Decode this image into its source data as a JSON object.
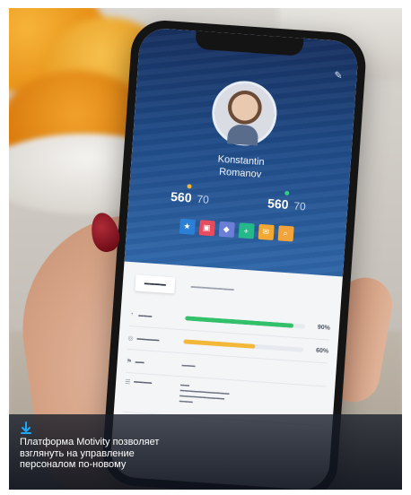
{
  "caption": {
    "line1": "Платформа Motivity позволяет",
    "line2": "взглянуть на управление",
    "line3": "персоналом по-новому",
    "accent": "#1ea7ff"
  },
  "phone_app": {
    "user_name_line1": "Konstantin",
    "user_name_line2": "Romanov",
    "stats": [
      {
        "main": "560",
        "sub": "70",
        "dot": "#f5b731"
      },
      {
        "main": "560",
        "sub": "70",
        "dot": "#2fd27a"
      }
    ],
    "actions": [
      {
        "icon": "star-icon",
        "glyph": "★",
        "color": "#2b7fd6"
      },
      {
        "icon": "gift-icon",
        "glyph": "▣",
        "color": "#e74c5e"
      },
      {
        "icon": "chat-icon",
        "glyph": "◆",
        "color": "#6c7fd8"
      },
      {
        "icon": "plus-icon",
        "glyph": "+",
        "color": "#25b88a"
      },
      {
        "icon": "mail-icon",
        "glyph": "✉",
        "color": "#f2a933"
      },
      {
        "icon": "search-icon",
        "glyph": "⌕",
        "color": "#f0a43a"
      }
    ],
    "bars": [
      {
        "pct": "90%",
        "fill": 0.9,
        "color": "#33c06b"
      },
      {
        "pct": "60%",
        "fill": 0.6,
        "color": "#f3b73a"
      }
    ]
  }
}
